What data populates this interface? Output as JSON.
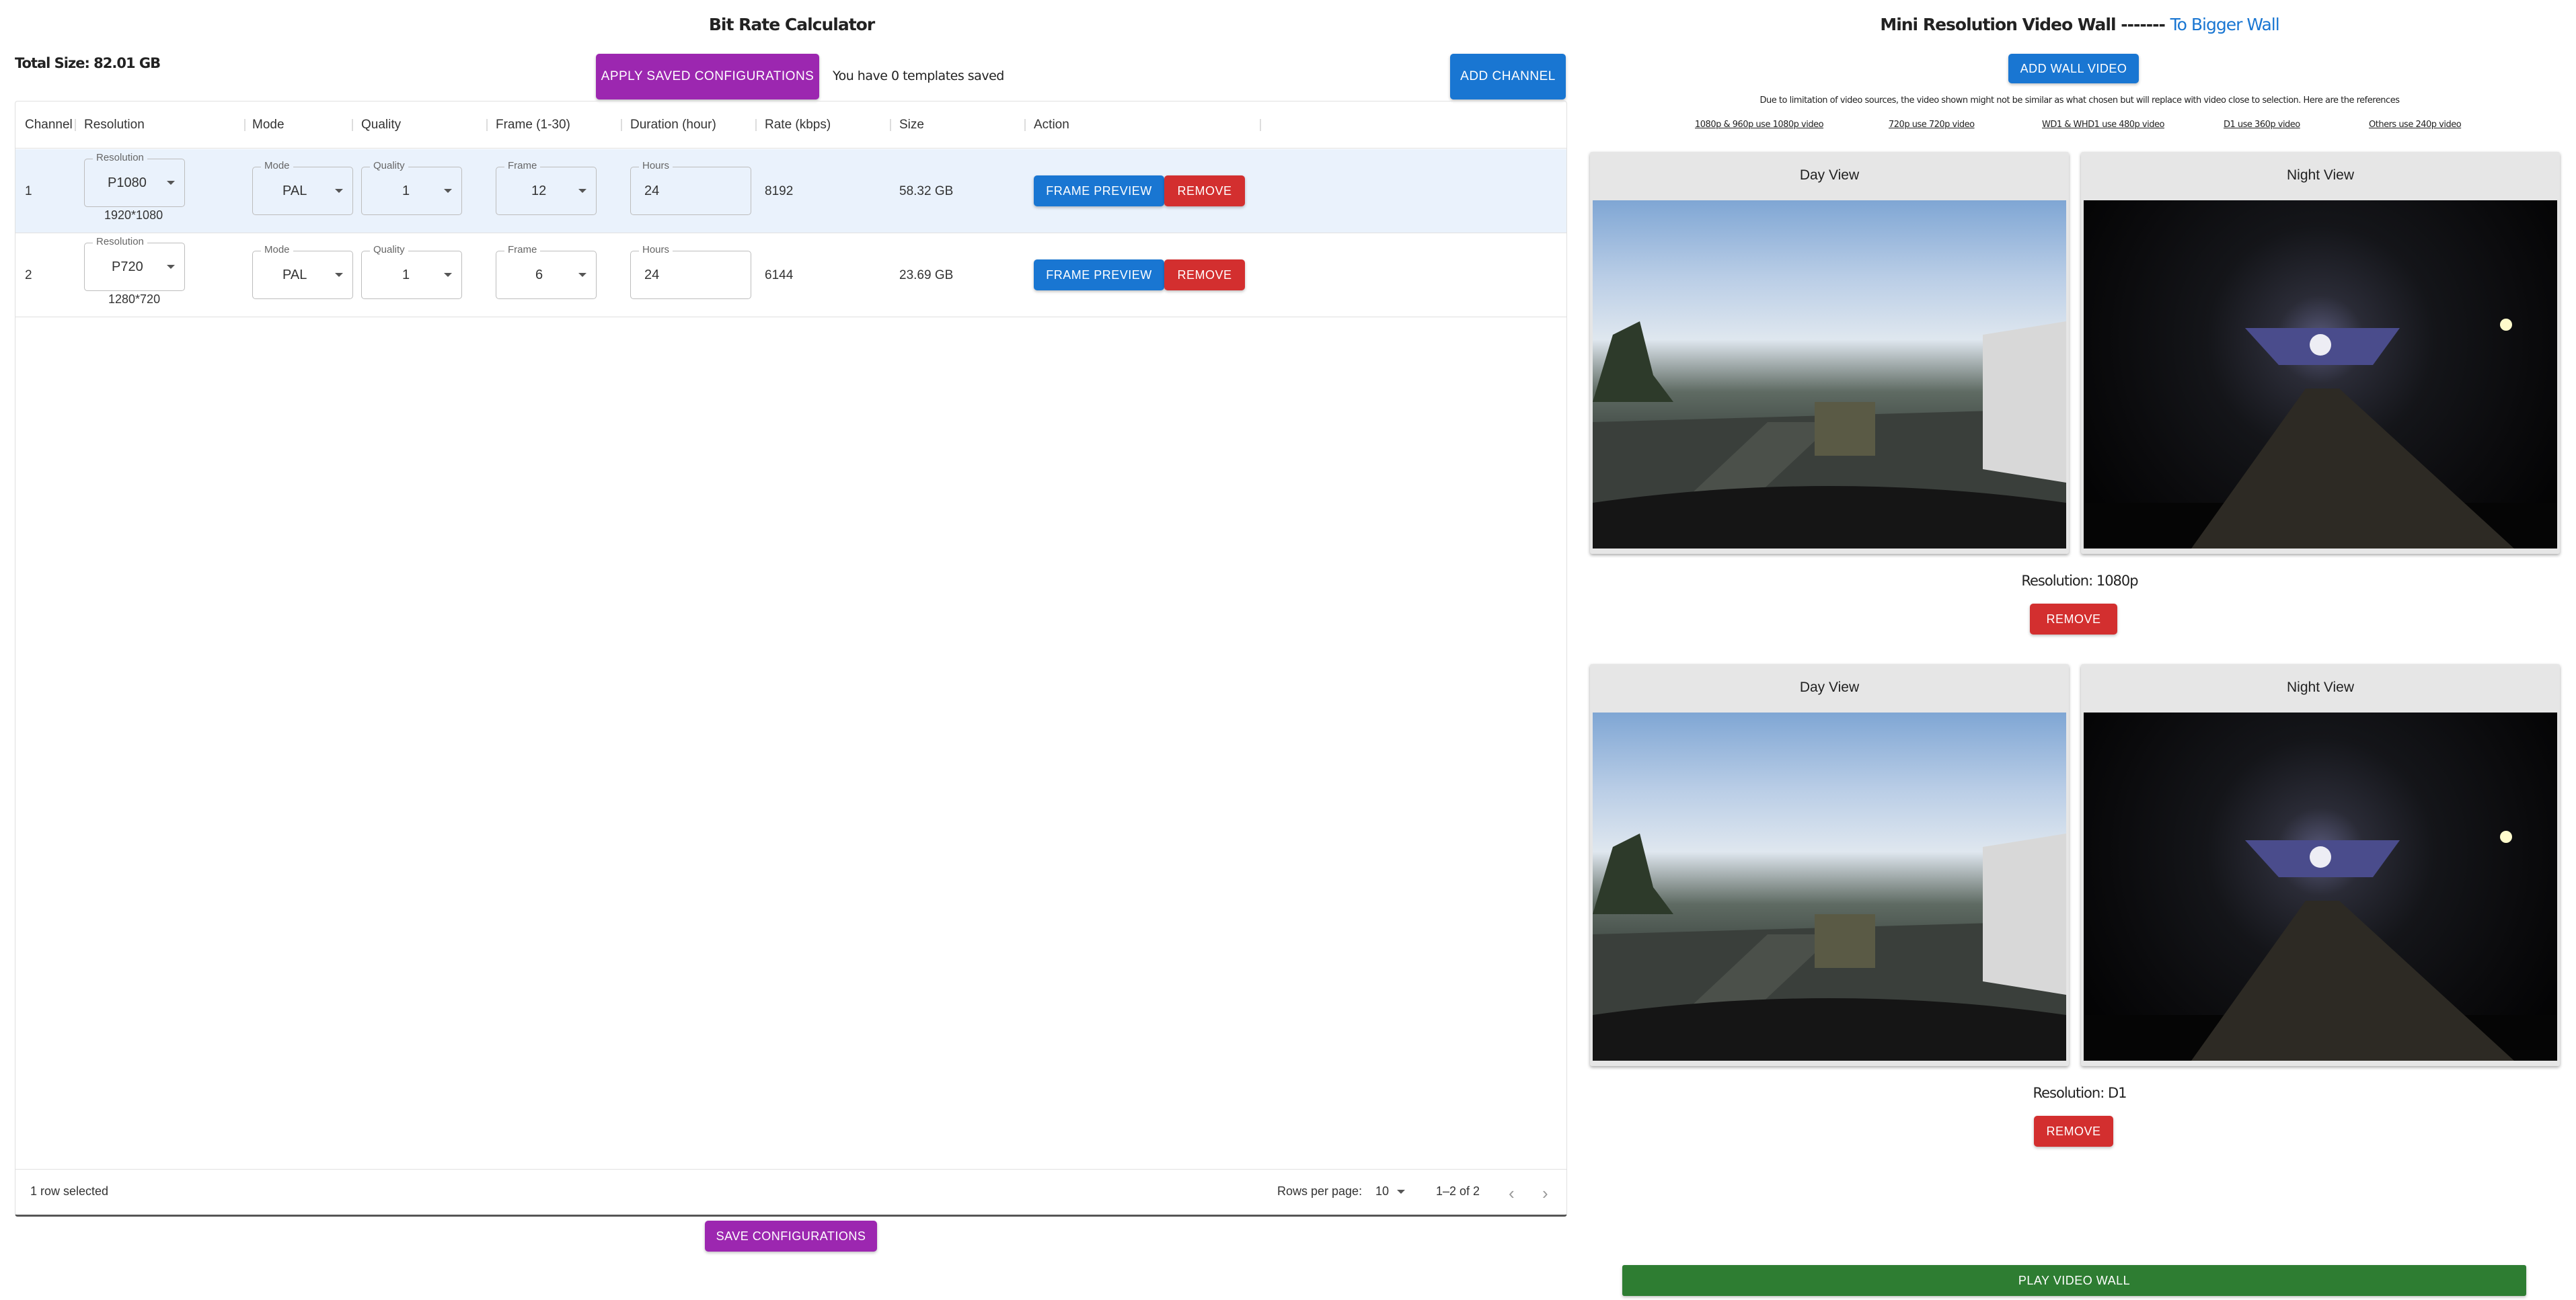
{
  "calculator": {
    "title": "Bit Rate Calculator",
    "total_size": "Total Size: 82.01 GB",
    "apply_saved_label": "APPLY SAVED CONFIGURATIONS",
    "templates_text": "You have 0 templates saved",
    "add_channel_label": "ADD CHANNEL",
    "save_label": "SAVE CONFIGURATIONS",
    "columns": [
      "Channel",
      "Resolution",
      "Mode",
      "Quality",
      "Frame (1-30)",
      "Duration (hour)",
      "Rate (kbps)",
      "Size",
      "Action"
    ],
    "field_labels": {
      "resolution": "Resolution",
      "mode": "Mode",
      "quality": "Quality",
      "frame": "Frame",
      "hours": "Hours"
    },
    "rows": [
      {
        "channel": "1",
        "resolution": "P1080",
        "resolution_px": "1920*1080",
        "mode": "PAL",
        "quality": "1",
        "frame": "12",
        "hours": "24",
        "rate": "8192",
        "size": "58.32 GB",
        "selected": true
      },
      {
        "channel": "2",
        "resolution": "P720",
        "resolution_px": "1280*720",
        "mode": "PAL",
        "quality": "1",
        "frame": "6",
        "hours": "24",
        "rate": "6144",
        "size": "23.69 GB",
        "selected": false
      }
    ],
    "frame_preview_label": "FRAME PREVIEW",
    "remove_label": "REMOVE",
    "footer": {
      "selected": "1 row selected",
      "rows_per_page_label": "Rows per page:",
      "rows_per_page": "10",
      "pagination": "1–2 of 2"
    }
  },
  "wall": {
    "title": "Mini Resolution Video Wall -------",
    "bigger_link": "To Bigger Wall",
    "add_wall_label": "ADD WALL VIDEO",
    "note": "Due to limitation of video sources, the video shown might not be similar as what chosen but will replace with video close to selection. Here are the references",
    "references": [
      "1080p & 960p use 1080p video",
      "720p use 720p video",
      "WD1 & WHD1 use 480p video",
      "D1 use 360p video",
      "Others use 240p video"
    ],
    "groups": [
      {
        "day_title": "Day View",
        "night_title": "Night View",
        "resolution": "Resolution: 1080p",
        "remove": "REMOVE"
      },
      {
        "day_title": "Day View",
        "night_title": "Night View",
        "resolution": "Resolution: D1",
        "remove": "REMOVE"
      }
    ],
    "play_label": "PLAY VIDEO WALL"
  },
  "colors": {
    "primary": "#1976d2",
    "secondary": "#9c27b0",
    "error": "#d32f2f",
    "success": "#2e7d32",
    "selected_row": "#eaf2fc"
  }
}
